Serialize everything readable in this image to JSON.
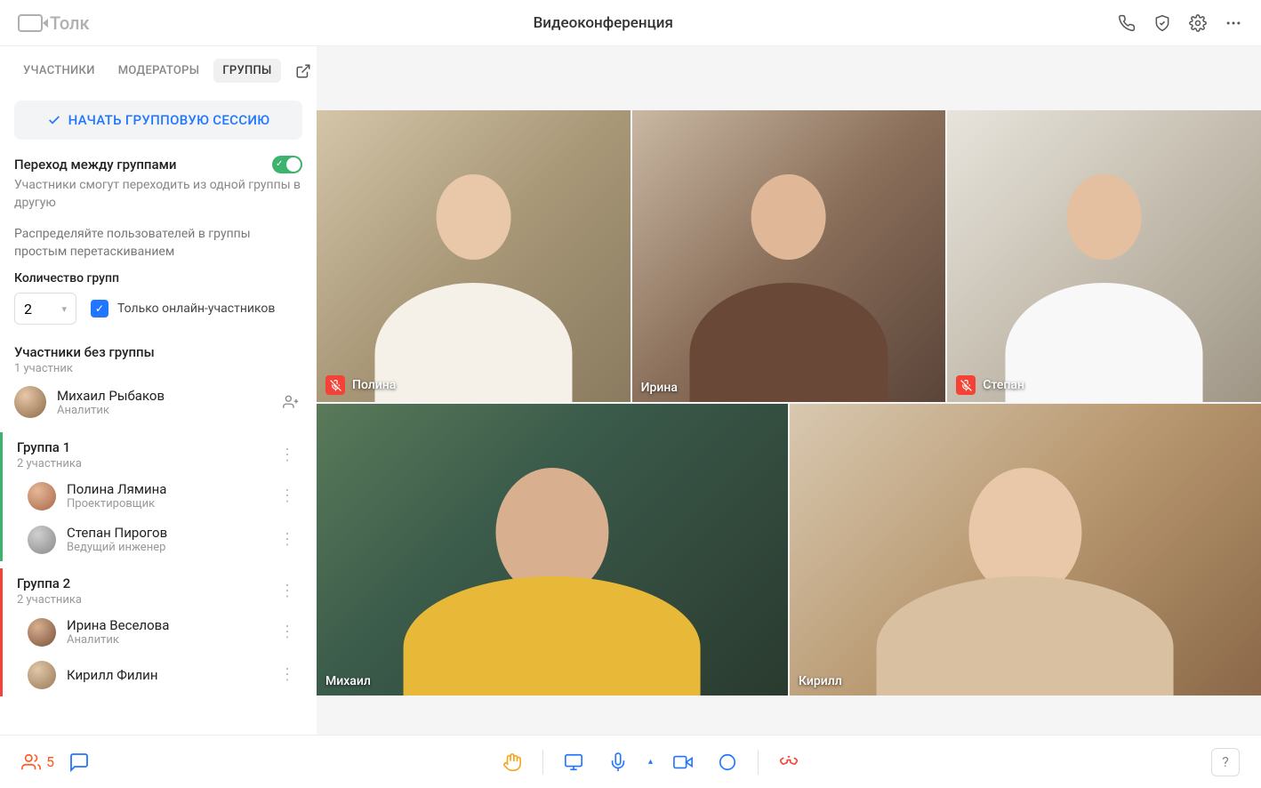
{
  "header": {
    "app_name": "Толк",
    "title": "Видеоконференция"
  },
  "tabs": {
    "participants": "УЧАСТНИКИ",
    "moderators": "МОДЕРАТОРЫ",
    "groups": "ГРУППЫ"
  },
  "sidebar": {
    "start_session": "НАЧАТЬ ГРУППОВУЮ СЕССИЮ",
    "transition_title": "Переход между группами",
    "transition_sub": "Участники смогут переходить из одной группы в другую",
    "distribute_hint": "Распределяйте пользователей в группы простым перетаскиванием",
    "group_count_label": "Количество групп",
    "group_count_value": "2",
    "online_only_label": "Только онлайн-участников",
    "ungrouped_title": "Участники без группы",
    "ungrouped_count": "1 участник",
    "ungrouped_members": [
      {
        "name": "Михаил Рыбаков",
        "role": "Аналитик",
        "avatar": "av-m"
      }
    ],
    "groups": [
      {
        "title": "Группа 1",
        "count": "2 участника",
        "cls": "group-1",
        "members": [
          {
            "name": "Полина Лямина",
            "role": "Проектировщик",
            "avatar": "av-p"
          },
          {
            "name": "Степан Пирогов",
            "role": "Ведущий инженер",
            "avatar": "av-s"
          }
        ]
      },
      {
        "title": "Группа 2",
        "count": "2 участника",
        "cls": "group-2",
        "members": [
          {
            "name": "Ирина Веселова",
            "role": "Аналитик",
            "avatar": "av-i"
          },
          {
            "name": "Кирилл Филин",
            "role": "",
            "avatar": "av-k"
          }
        ]
      }
    ]
  },
  "video": {
    "tiles": [
      {
        "name": "Полина",
        "muted": true,
        "active": false,
        "bg": "bg1",
        "sk": "sk1"
      },
      {
        "name": "Ирина",
        "muted": false,
        "active": true,
        "bg": "bg2",
        "sk": "sk2"
      },
      {
        "name": "Степан",
        "muted": true,
        "active": false,
        "bg": "bg3",
        "sk": "sk3"
      },
      {
        "name": "Михаил",
        "muted": false,
        "active": false,
        "bg": "bg4",
        "sk": "sk4"
      },
      {
        "name": "Кирилл",
        "muted": false,
        "active": false,
        "bg": "bg5",
        "sk": "sk5"
      }
    ]
  },
  "bottombar": {
    "people_count": "5",
    "help": "?"
  }
}
